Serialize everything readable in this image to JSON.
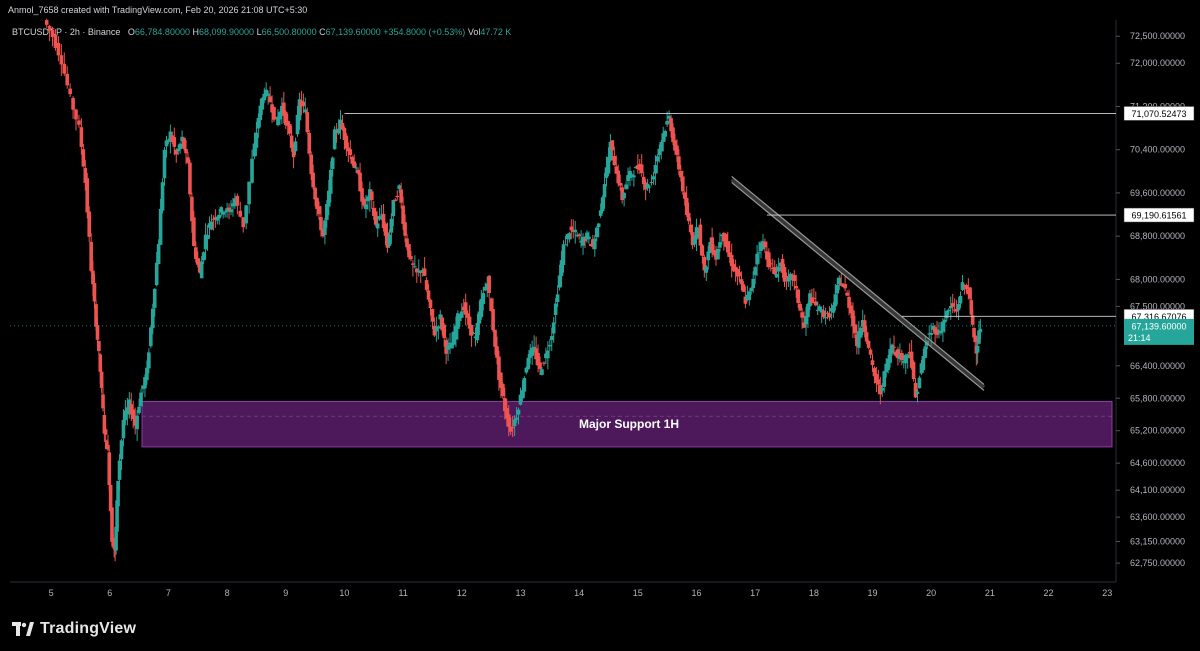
{
  "header": {
    "credit": "Anmol_7658 created with TradingView.com, Feb 20, 2026 21:08 UTC+5:30"
  },
  "legend": {
    "symbol": "BTCUSDT.P · 2h · Binance",
    "o_label": "O",
    "o_value": "66,784.80000",
    "h_label": "H",
    "h_value": "68,099.90000",
    "l_label": "L",
    "l_value": "66,500.80000",
    "c_label": "C",
    "c_value": "67,139.60000",
    "change": "+354.8000 (+0.53%)",
    "vol_label": "Vol",
    "vol_value": "47.72 K"
  },
  "footer": {
    "brand": "TradingView"
  },
  "colors": {
    "up": "#26a69a",
    "down": "#ef5350",
    "support_zone": "#5b1d6b",
    "support_border": "#8e3aa6",
    "price_tag": "#26a69a"
  },
  "chart_data": {
    "type": "candlestick",
    "symbol": "BTCUSDT.P",
    "timeframe": "2h",
    "exchange": "Binance",
    "x_ticks": [
      "5",
      "6",
      "7",
      "8",
      "9",
      "10",
      "11",
      "12",
      "13",
      "14",
      "15",
      "16",
      "17",
      "18",
      "19",
      "20",
      "21",
      "22",
      "23"
    ],
    "y_ticks": [
      "72,500.00000",
      "72,000.00000",
      "71,200.00000",
      "70,400.00000",
      "69,600.00000",
      "68,800.00000",
      "68,000.00000",
      "67,500.00000",
      "66,400.00000",
      "65,800.00000",
      "65,200.00000",
      "64,600.00000",
      "64,100.00000",
      "63,600.00000",
      "63,150.00000",
      "62,750.00000"
    ],
    "ylim": [
      62400,
      72800
    ],
    "horizontal_levels": [
      {
        "price": 71070.52473,
        "label": "71,070.52473",
        "from_day": 10.0
      },
      {
        "price": 69190.61561,
        "label": "69,190.61561",
        "from_day": 17.2
      },
      {
        "price": 67316.67076,
        "label": "67,316.67076",
        "from_day": 19.5
      }
    ],
    "last_price": {
      "price": 67139.6,
      "label": "67,139.60000",
      "countdown": "21:14"
    },
    "support_zone": {
      "label": "Major Support 1H",
      "from_day": 6.55,
      "price_top": 65740,
      "price_bottom": 64900
    },
    "trendline": {
      "from": {
        "day": 16.6,
        "price": 69850
      },
      "to": {
        "day": 20.9,
        "price": 66000
      }
    },
    "price_path": [
      [
        4.9,
        72800
      ],
      [
        5.05,
        72500
      ],
      [
        5.2,
        72050
      ],
      [
        5.35,
        71350
      ],
      [
        5.5,
        70800
      ],
      [
        5.6,
        69800
      ],
      [
        5.7,
        68200
      ],
      [
        5.78,
        67200
      ],
      [
        5.85,
        66300
      ],
      [
        5.92,
        65200
      ],
      [
        5.98,
        64800
      ],
      [
        6.05,
        63200
      ],
      [
        6.1,
        62950
      ],
      [
        6.15,
        64300
      ],
      [
        6.25,
        65400
      ],
      [
        6.35,
        65700
      ],
      [
        6.45,
        65300
      ],
      [
        6.55,
        65900
      ],
      [
        6.65,
        66300
      ],
      [
        6.75,
        67500
      ],
      [
        6.85,
        68700
      ],
      [
        6.95,
        70400
      ],
      [
        7.05,
        70700
      ],
      [
        7.15,
        70300
      ],
      [
        7.25,
        70600
      ],
      [
        7.35,
        70100
      ],
      [
        7.45,
        68600
      ],
      [
        7.55,
        68100
      ],
      [
        7.65,
        68800
      ],
      [
        7.75,
        69100
      ],
      [
        7.85,
        69200
      ],
      [
        7.95,
        69300
      ],
      [
        8.05,
        69250
      ],
      [
        8.15,
        69500
      ],
      [
        8.3,
        69000
      ],
      [
        8.45,
        70200
      ],
      [
        8.55,
        71000
      ],
      [
        8.65,
        71500
      ],
      [
        8.75,
        71300
      ],
      [
        8.85,
        70900
      ],
      [
        8.95,
        71200
      ],
      [
        9.05,
        70800
      ],
      [
        9.15,
        70300
      ],
      [
        9.25,
        71300
      ],
      [
        9.35,
        71100
      ],
      [
        9.45,
        70000
      ],
      [
        9.55,
        69300
      ],
      [
        9.65,
        68800
      ],
      [
        9.75,
        69600
      ],
      [
        9.85,
        70700
      ],
      [
        9.95,
        70900
      ],
      [
        10.05,
        70500
      ],
      [
        10.15,
        70200
      ],
      [
        10.25,
        69900
      ],
      [
        10.35,
        69300
      ],
      [
        10.45,
        69600
      ],
      [
        10.55,
        69000
      ],
      [
        10.65,
        69200
      ],
      [
        10.75,
        68600
      ],
      [
        10.85,
        69400
      ],
      [
        10.95,
        69700
      ],
      [
        11.05,
        68800
      ],
      [
        11.15,
        68300
      ],
      [
        11.25,
        68100
      ],
      [
        11.35,
        68200
      ],
      [
        11.45,
        67600
      ],
      [
        11.55,
        67000
      ],
      [
        11.65,
        67300
      ],
      [
        11.75,
        66700
      ],
      [
        11.85,
        66800
      ],
      [
        11.95,
        67300
      ],
      [
        12.05,
        67500
      ],
      [
        12.15,
        67100
      ],
      [
        12.25,
        66900
      ],
      [
        12.35,
        67600
      ],
      [
        12.45,
        68000
      ],
      [
        12.55,
        67100
      ],
      [
        12.65,
        66200
      ],
      [
        12.75,
        65600
      ],
      [
        12.85,
        65200
      ],
      [
        12.95,
        65500
      ],
      [
        13.05,
        66000
      ],
      [
        13.15,
        66600
      ],
      [
        13.25,
        66700
      ],
      [
        13.35,
        66300
      ],
      [
        13.45,
        66600
      ],
      [
        13.55,
        67000
      ],
      [
        13.65,
        67800
      ],
      [
        13.75,
        68600
      ],
      [
        13.85,
        68900
      ],
      [
        13.95,
        68850
      ],
      [
        14.05,
        68700
      ],
      [
        14.15,
        68800
      ],
      [
        14.25,
        68600
      ],
      [
        14.35,
        69100
      ],
      [
        14.45,
        69800
      ],
      [
        14.55,
        70500
      ],
      [
        14.65,
        70000
      ],
      [
        14.75,
        69500
      ],
      [
        14.85,
        69900
      ],
      [
        14.95,
        70000
      ],
      [
        15.05,
        70100
      ],
      [
        15.15,
        69700
      ],
      [
        15.25,
        69800
      ],
      [
        15.35,
        70300
      ],
      [
        15.45,
        70700
      ],
      [
        15.55,
        71000
      ],
      [
        15.65,
        70400
      ],
      [
        15.75,
        69900
      ],
      [
        15.85,
        69200
      ],
      [
        15.95,
        68700
      ],
      [
        16.05,
        69000
      ],
      [
        16.15,
        68100
      ],
      [
        16.25,
        68700
      ],
      [
        16.35,
        68400
      ],
      [
        16.45,
        68900
      ],
      [
        16.55,
        68500
      ],
      [
        16.65,
        68200
      ],
      [
        16.75,
        68000
      ],
      [
        16.85,
        67600
      ],
      [
        16.95,
        67800
      ],
      [
        17.05,
        68500
      ],
      [
        17.15,
        68700
      ],
      [
        17.25,
        68300
      ],
      [
        17.35,
        68100
      ],
      [
        17.45,
        68300
      ],
      [
        17.55,
        67900
      ],
      [
        17.65,
        68100
      ],
      [
        17.75,
        67600
      ],
      [
        17.85,
        67100
      ],
      [
        17.95,
        67700
      ],
      [
        18.05,
        67500
      ],
      [
        18.15,
        67400
      ],
      [
        18.25,
        67300
      ],
      [
        18.35,
        67500
      ],
      [
        18.45,
        68000
      ],
      [
        18.55,
        67800
      ],
      [
        18.65,
        67400
      ],
      [
        18.75,
        66800
      ],
      [
        18.85,
        67300
      ],
      [
        18.95,
        66700
      ],
      [
        19.05,
        66200
      ],
      [
        19.15,
        65900
      ],
      [
        19.25,
        66400
      ],
      [
        19.35,
        66800
      ],
      [
        19.45,
        66600
      ],
      [
        19.55,
        66500
      ],
      [
        19.65,
        66700
      ],
      [
        19.75,
        65800
      ],
      [
        19.85,
        66400
      ],
      [
        19.95,
        66900
      ],
      [
        20.05,
        67100
      ],
      [
        20.15,
        67000
      ],
      [
        20.25,
        67300
      ],
      [
        20.35,
        67500
      ],
      [
        20.45,
        67400
      ],
      [
        20.55,
        67900
      ],
      [
        20.65,
        67800
      ],
      [
        20.72,
        67100
      ],
      [
        20.78,
        66700
      ],
      [
        20.85,
        67140
      ]
    ]
  }
}
